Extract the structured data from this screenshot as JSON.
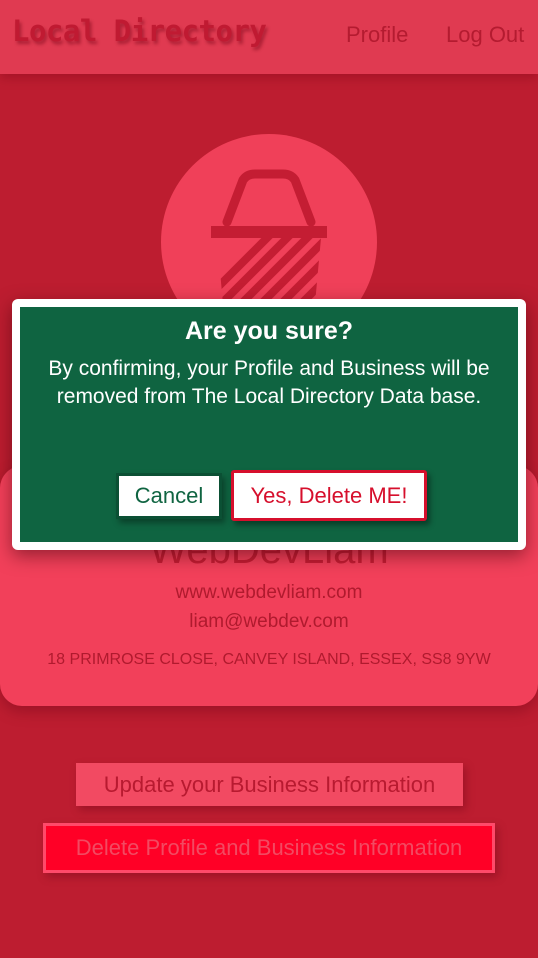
{
  "header": {
    "brand": "Local Directory",
    "nav": {
      "profile": "Profile",
      "logout": "Log Out"
    }
  },
  "logo": {
    "icon": "basket-icon"
  },
  "business": {
    "name": "WebDevLiam",
    "website": "www.webdevliam.com",
    "email": "liam@webdev.com",
    "address": "18 PRIMROSE CLOSE, CANVEY ISLAND, ESSEX, SS8 9YW"
  },
  "actions": {
    "update_label": "Update your Business Information",
    "delete_label": "Delete Profile and Business Information"
  },
  "modal": {
    "title": "Are you sure?",
    "message": "By confirming, your Profile and Business will be removed from The Local Directory Data base.",
    "cancel_label": "Cancel",
    "confirm_label": "Yes, Delete ME!"
  },
  "colors": {
    "page_background": "#bd1d30",
    "header_background": "#e03a51",
    "modal_background": "#0f6441",
    "danger": "#ff0026"
  }
}
